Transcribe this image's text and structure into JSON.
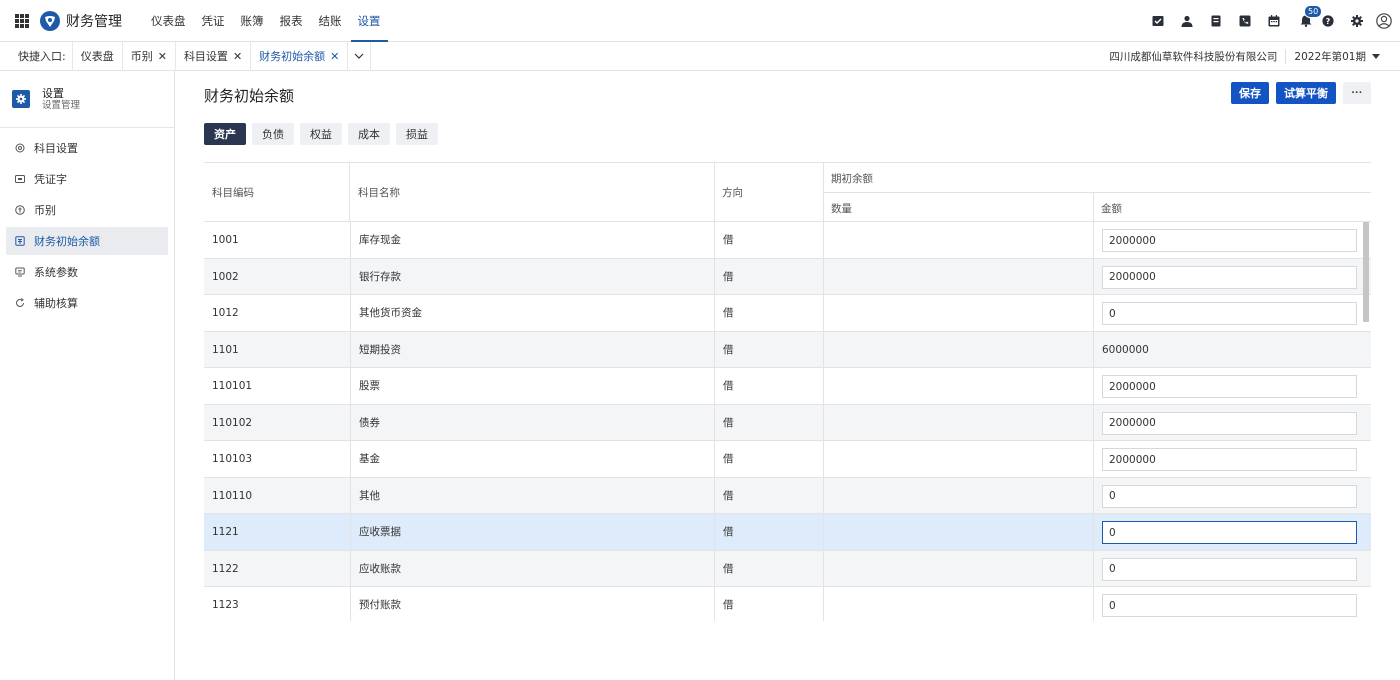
{
  "app": {
    "title": "财务管理"
  },
  "topnav": [
    {
      "label": "仪表盘",
      "active": false
    },
    {
      "label": "凭证",
      "active": false
    },
    {
      "label": "账簿",
      "active": false
    },
    {
      "label": "报表",
      "active": false
    },
    {
      "label": "结账",
      "active": false
    },
    {
      "label": "设置",
      "active": true
    }
  ],
  "notifications": {
    "count": "50"
  },
  "quickbar": {
    "label": "快捷入口:",
    "tabs": [
      {
        "label": "仪表盘",
        "closable": false,
        "active": false
      },
      {
        "label": "币别",
        "closable": true,
        "active": false
      },
      {
        "label": "科目设置",
        "closable": true,
        "active": false
      },
      {
        "label": "财务初始余额",
        "closable": true,
        "active": true
      }
    ],
    "company": "四川成都仙草软件科技股份有限公司",
    "period": "2022年第01期"
  },
  "sidebar": {
    "title": "设置",
    "subtitle": "设置管理",
    "items": [
      {
        "label": "科目设置",
        "icon": "tree-icon",
        "active": false
      },
      {
        "label": "凭证字",
        "icon": "voucher-icon",
        "active": false
      },
      {
        "label": "币别",
        "icon": "currency-icon",
        "active": false
      },
      {
        "label": "财务初始余额",
        "icon": "balance-icon",
        "active": true
      },
      {
        "label": "系统参数",
        "icon": "params-icon",
        "active": false
      },
      {
        "label": "辅助核算",
        "icon": "refresh-icon",
        "active": false
      }
    ]
  },
  "main": {
    "title": "财务初始余额",
    "save_label": "保存",
    "trial_label": "试算平衡",
    "more_label": "···",
    "tabs": [
      {
        "label": "资产",
        "active": true
      },
      {
        "label": "负债",
        "active": false
      },
      {
        "label": "权益",
        "active": false
      },
      {
        "label": "成本",
        "active": false
      },
      {
        "label": "损益",
        "active": false
      }
    ]
  },
  "table": {
    "headers": {
      "code": "科目编码",
      "name": "科目名称",
      "direction": "方向",
      "opening": "期初余额",
      "quantity": "数量",
      "amount": "金额"
    },
    "rows": [
      {
        "code": "1001",
        "name": "库存现金",
        "direction": "借",
        "quantity": "",
        "amount": "2000000",
        "editable": true
      },
      {
        "code": "1002",
        "name": "银行存款",
        "direction": "借",
        "quantity": "",
        "amount": "2000000",
        "editable": true
      },
      {
        "code": "1012",
        "name": "其他货币资金",
        "direction": "借",
        "quantity": "",
        "amount": "0",
        "editable": true
      },
      {
        "code": "1101",
        "name": "短期投资",
        "direction": "借",
        "quantity": "",
        "amount": "6000000",
        "editable": false
      },
      {
        "code": "110101",
        "name": "股票",
        "direction": "借",
        "quantity": "",
        "amount": "2000000",
        "editable": true
      },
      {
        "code": "110102",
        "name": "债券",
        "direction": "借",
        "quantity": "",
        "amount": "2000000",
        "editable": true
      },
      {
        "code": "110103",
        "name": "基金",
        "direction": "借",
        "quantity": "",
        "amount": "2000000",
        "editable": true
      },
      {
        "code": "110110",
        "name": "其他",
        "direction": "借",
        "quantity": "",
        "amount": "0",
        "editable": true
      },
      {
        "code": "1121",
        "name": "应收票据",
        "direction": "借",
        "quantity": "",
        "amount": "0",
        "editable": true,
        "selected": true
      },
      {
        "code": "1122",
        "name": "应收账款",
        "direction": "借",
        "quantity": "",
        "amount": "0",
        "editable": true
      },
      {
        "code": "1123",
        "name": "预付账款",
        "direction": "借",
        "quantity": "",
        "amount": "0",
        "editable": true
      }
    ]
  },
  "colors": {
    "primary": "#1453c4",
    "accent": "#1e5aa8",
    "dark_tab": "#2b3750",
    "selected_row": "#deebfa"
  }
}
